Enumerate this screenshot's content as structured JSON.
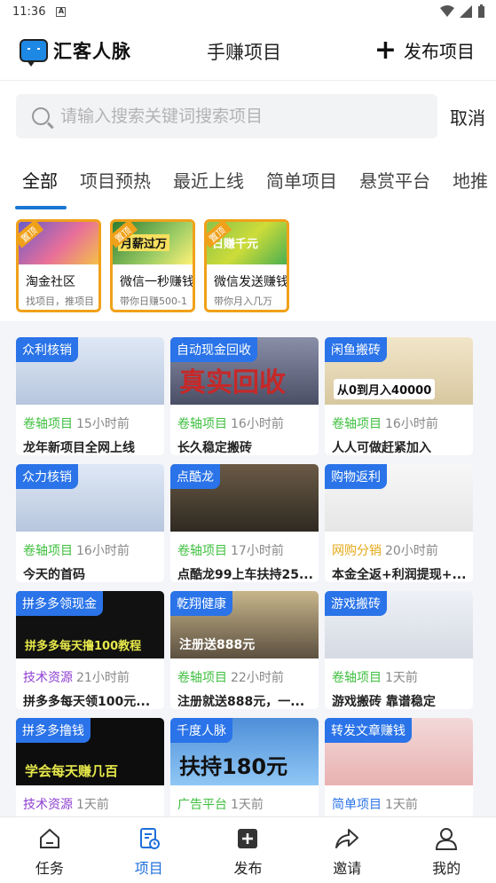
{
  "status_bar": {
    "time": "11:36",
    "indicator": "A"
  },
  "header": {
    "logo_text": "汇客人脉",
    "title": "手赚项目",
    "publish_label": "发布项目"
  },
  "search": {
    "placeholder": "请输入搜索关键词搜索项目",
    "value": "",
    "cancel_label": "取消"
  },
  "tabs": [
    "全部",
    "项目预热",
    "最近上线",
    "简单项目",
    "悬赏平台",
    "地推"
  ],
  "featured": [
    {
      "badge": "置顶",
      "img_text": "",
      "title": "淘金社区",
      "subtitle": "找项目，推项目"
    },
    {
      "badge": "置顶",
      "img_text": "月薪过万",
      "title": "微信一秒赚钱",
      "subtitle": "带你日赚500-1"
    },
    {
      "badge": "置顶",
      "img_text": "日赚千元",
      "title": "微信发送赚钱",
      "subtitle": "带你月入几万"
    }
  ],
  "cards": [
    {
      "tag": "众利核销",
      "img_text": "",
      "category": "卷轴项目",
      "category_color": "#3fbf3f",
      "time": "15小时前",
      "title": "龙年新项目全网上线"
    },
    {
      "tag": "自动现金回收",
      "img_text": "真实回收",
      "category": "卷轴项目",
      "category_color": "#3fbf3f",
      "time": "16小时前",
      "title": "长久稳定搬砖"
    },
    {
      "tag": "闲鱼搬砖",
      "img_text": "从0到月入40000",
      "category": "卷轴项目",
      "category_color": "#3fbf3f",
      "time": "16小时前",
      "title": "人人可做赶紧加入"
    },
    {
      "tag": "众力核销",
      "img_text": "",
      "category": "卷轴项目",
      "category_color": "#3fbf3f",
      "time": "16小时前",
      "title": "今天的首码"
    },
    {
      "tag": "点酷龙",
      "img_text": "",
      "category": "卷轴项目",
      "category_color": "#3fbf3f",
      "time": "17小时前",
      "title": "点酷龙99上车扶持25..."
    },
    {
      "tag": "购物返利",
      "img_text": "",
      "category": "网购分销",
      "category_color": "#e6a817",
      "time": "20小时前",
      "title": "本金全返+利润提现+..."
    },
    {
      "tag": "拼多多领现金",
      "img_text": "拼多多每天撸100教程",
      "category": "技术资源",
      "category_color": "#8e3fd1",
      "time": "21小时前",
      "title": "拼多多每天领100元..."
    },
    {
      "tag": "乾翔健康",
      "img_text": "注册送888元",
      "category": "卷轴项目",
      "category_color": "#3fbf3f",
      "time": "22小时前",
      "title": "注册就送888元，一..."
    },
    {
      "tag": "游戏搬砖",
      "img_text": "",
      "category": "卷轴项目",
      "category_color": "#3fbf3f",
      "time": "1天前",
      "title": "游戏搬砖 靠谱稳定"
    },
    {
      "tag": "拼多多撸钱",
      "img_text": "学会每天赚几百",
      "category": "技术资源",
      "category_color": "#8e3fd1",
      "time": "1天前",
      "title": ""
    },
    {
      "tag": "千度人脉",
      "img_text": "扶持180元",
      "category": "广告平台",
      "category_color": "#3fbf3f",
      "time": "1天前",
      "title": ""
    },
    {
      "tag": "转发文章赚钱",
      "img_text": "",
      "category": "简单项目",
      "category_color": "#2a73e8",
      "time": "1天前",
      "title": ""
    }
  ],
  "bottom_nav": [
    {
      "label": "任务",
      "icon": "home-icon",
      "active": false
    },
    {
      "label": "项目",
      "icon": "project-icon",
      "active": true
    },
    {
      "label": "发布",
      "icon": "add-box-icon",
      "active": false
    },
    {
      "label": "邀请",
      "icon": "share-icon",
      "active": false
    },
    {
      "label": "我的",
      "icon": "profile-icon",
      "active": false
    }
  ],
  "colors": {
    "accent": "#1e6fd9",
    "tag_bg": "#2a73e8",
    "featured_border": "#f0a11a"
  }
}
